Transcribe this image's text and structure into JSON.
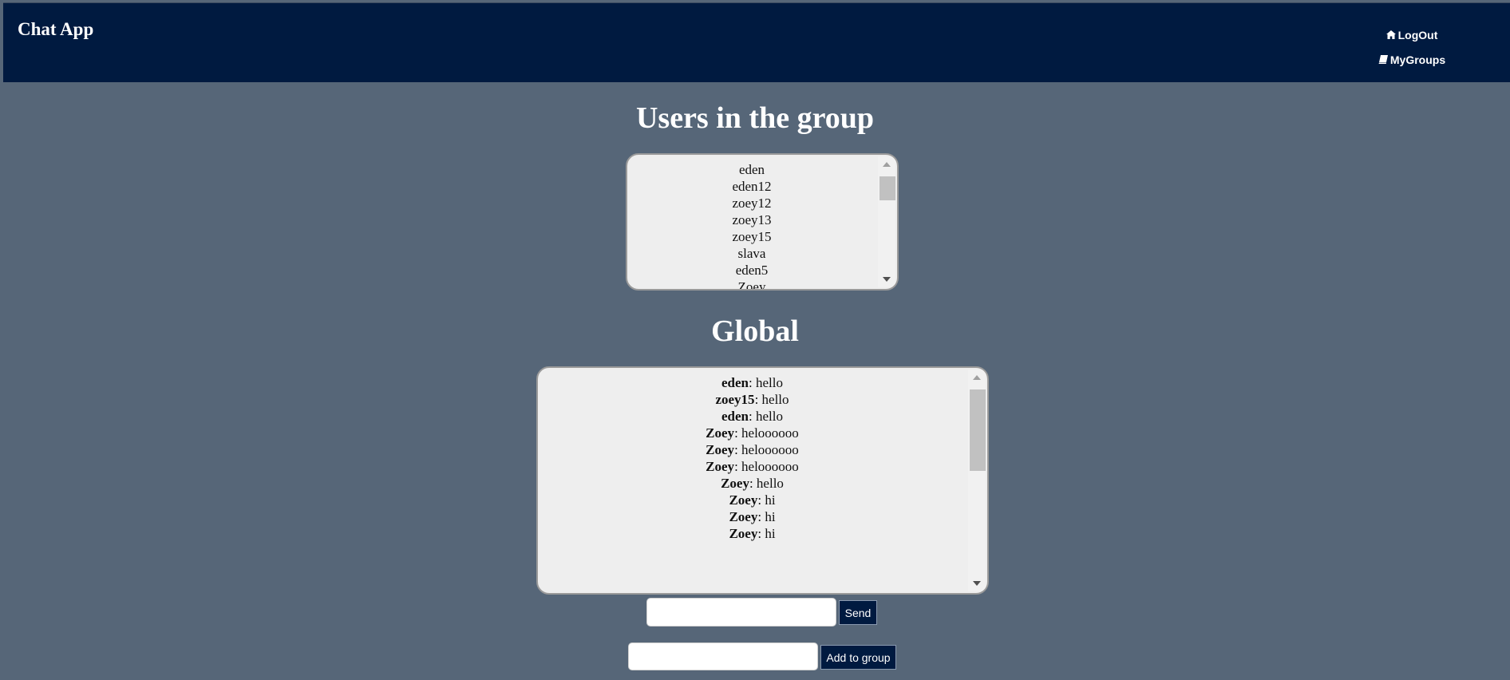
{
  "navbar": {
    "brand": "Chat App",
    "logout_label": "LogOut",
    "mygroups_label": "MyGroups"
  },
  "users_section": {
    "title": "Users in the group",
    "users": [
      "eden",
      "eden12",
      "zoey12",
      "zoey13",
      "zoey15",
      "slava",
      "eden5",
      "Zoey"
    ]
  },
  "chat_section": {
    "title": "Global",
    "messages": [
      {
        "user": "eden",
        "text": ": hello"
      },
      {
        "user": "zoey15",
        "text": ": hello"
      },
      {
        "user": "eden",
        "text": ": hello"
      },
      {
        "user": "Zoey",
        "text": ": heloooooo"
      },
      {
        "user": "Zoey",
        "text": ": heloooooo"
      },
      {
        "user": "Zoey",
        "text": ": heloooooo"
      },
      {
        "user": "Zoey",
        "text": ": hello"
      },
      {
        "user": "Zoey",
        "text": ": hi"
      },
      {
        "user": "Zoey",
        "text": ": hi"
      },
      {
        "user": "Zoey",
        "text": ": hi"
      }
    ]
  },
  "message_form": {
    "input_value": "",
    "send_label": "Send"
  },
  "add_form": {
    "input_value": "",
    "add_label": "Add to group"
  },
  "colors": {
    "navbar_bg": "#001a40",
    "page_bg": "#566678",
    "panel_bg": "#eeeeee"
  }
}
